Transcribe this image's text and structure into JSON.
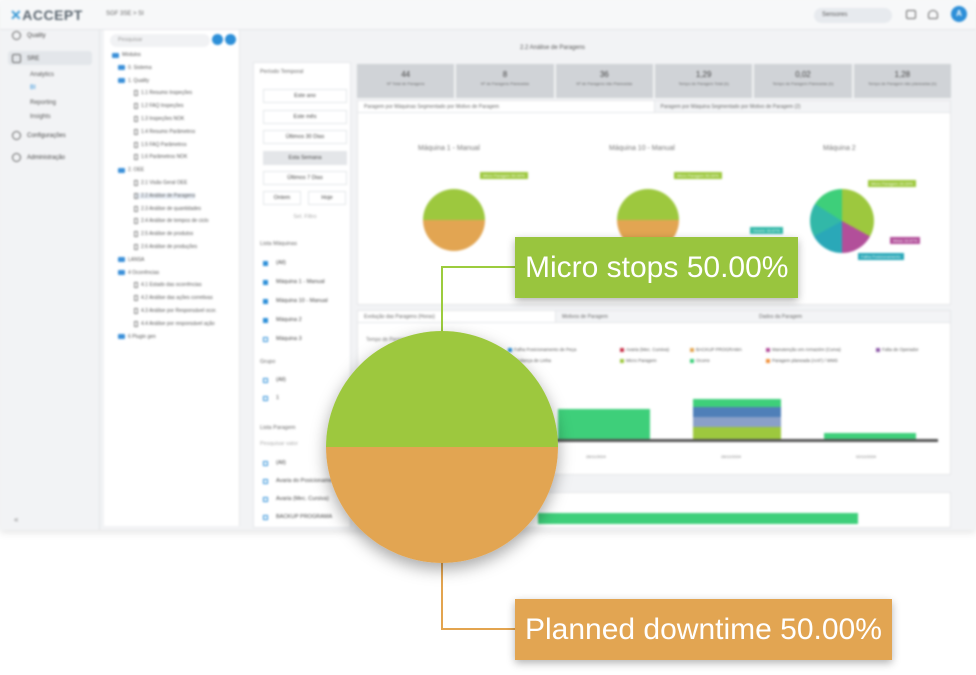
{
  "app": {
    "logo": "ACCEPT",
    "breadcrumb": "SGF 3SE > SI",
    "search_value": "Sensores",
    "avatar_letter": "A",
    "nav": {
      "items": [
        {
          "label": "Quality",
          "icon": "quality-icon"
        },
        {
          "label": "SRE",
          "icon": "sre-icon"
        },
        {
          "label": "Configurações",
          "icon": "gear-icon"
        },
        {
          "label": "Administração",
          "icon": "admin-icon"
        }
      ],
      "sub_items": [
        "Analytics",
        "BI",
        "Reporting",
        "Insights"
      ]
    },
    "tree": {
      "search_placeholder": "Pesquisar",
      "rows": [
        "Módulos",
        "0. Sistema",
        "1. Quality",
        "1.1 Resumo Inspeções",
        "1.2 FAQ Inspeções",
        "1.3 Inspeções NOK",
        "1.4 Resumo Parâmetros",
        "1.5 FAQ Parâmetros",
        "1.6 Parâmetros NOK",
        "2. OEE",
        "2.1 Visão Geral OEE",
        "2.2 Análise de Paragens",
        "2.3 Análise de quantidades",
        "2.4 Análise de tempos de ciclo",
        "2.5 Análise de produtos",
        "2.6 Análise de produções",
        "LANSA",
        "4 Ocorrências",
        "4.1 Estado das ocorrências",
        "4.2 Análise das ações corretivas",
        "4.3 Análise por Responsável ocor.",
        "4.4 Análise por responsável ação",
        "6 Plugin gen"
      ]
    },
    "filters": {
      "period_title": "Período Temporal",
      "periods": [
        "Este ano",
        "Este mês",
        "Últimos 30 Dias",
        "Esta Semana",
        "Últimos 7 Dias"
      ],
      "half_buttons": [
        "Ontem",
        "Hoje"
      ],
      "custom": "Sel. Filtro",
      "machines_title": "Lista Máquinas",
      "machines": [
        "(All)",
        "Máquina 1 - Manual",
        "Máquina 10 - Manual",
        "Máquina 2",
        "Máquina 3"
      ],
      "groups_title": "Grupo",
      "groups": [
        "(All)",
        "1"
      ],
      "stops_title": "Lista Paragem",
      "stops_placeholder": "Pesquisar valor",
      "stops": [
        "(All)",
        "Avaria do Posicionamento",
        "Avaria (Mec. Cursiva)",
        "BACKUP PROGRAMA"
      ]
    },
    "page_title": "2.2 Análise de Paragens",
    "kpis": [
      {
        "value": "44",
        "label": "Nº Total de Paragens"
      },
      {
        "value": "8",
        "label": "Nº de Paragens Planeadas"
      },
      {
        "value": "36",
        "label": "Nº de Paragens não Planeadas"
      },
      {
        "value": "1,29",
        "label": "Tempo de Paragem Total (h)"
      },
      {
        "value": "0,02",
        "label": "Tempo de Paragem Planeadas (h)"
      },
      {
        "value": "1,28",
        "label": "Tempo de Paragem não planeadas (h)"
      }
    ],
    "pie_panel": {
      "tabs": [
        "Paragem por Máquinas Segmentado por Motivo de Paragem",
        "Paragem por Máquina Segmentado por Motivo de Paragem (2)"
      ],
      "titles": [
        "Máquina 1 - Manual",
        "Máquina 10 - Manual",
        "Máquina 2"
      ],
      "tags": [
        "Micro Paragem 50.00%",
        "Micro Paragem 50.00%",
        "Micro Paragem 33.33%",
        "Ocorre 16.67%",
        "Mesa 16.67%",
        "Falha Posicionamento"
      ],
      "tag_colors": {
        "green": "#9dc83e",
        "orange": "#e2a552",
        "teal": "#32b8a8",
        "purple": "#b24f9a",
        "cyan": "#2aa8b8"
      }
    },
    "evo_panel": {
      "tabs": [
        "Evolução das Paragens (Horas)",
        "Motivos de Paragem",
        "Dados da Paragem"
      ],
      "subtitle": "Tempo de Paragem",
      "legend": [
        "Falha Posicionamento de Peça",
        "Avaria (Mec. Cursiva)",
        "BACKUP PROGRAMA",
        "Manutenção em Armazém (Curva)",
        "Falta de Operador",
        "Mudança de Linha",
        "Micro Paragem",
        "Ocorre",
        "Paragem planeada (AAF) / WMS"
      ],
      "legend_colors": [
        "#2a8fd8",
        "#c8334a",
        "#e2a552",
        "#b24f9a",
        "#8e5aa8",
        "#4f7fb8",
        "#9dc83e",
        "#3ecf7a",
        "#f0903a"
      ],
      "x_labels": [
        "26/11/2024",
        "26/12/2024",
        "02/12/2024"
      ]
    }
  },
  "callouts": {
    "top_label": "Micro stops 50.00%",
    "bottom_label": "Planned downtime 50.00%",
    "colors": {
      "micro_stops": "#9dc83e",
      "planned_downtime": "#e2a552"
    }
  },
  "chart_data": {
    "type": "pie",
    "title": "",
    "slices": [
      {
        "name": "Micro stops",
        "value": 50.0,
        "color": "#9dc83e"
      },
      {
        "name": "Planned downtime",
        "value": 50.0,
        "color": "#e2a552"
      }
    ]
  }
}
